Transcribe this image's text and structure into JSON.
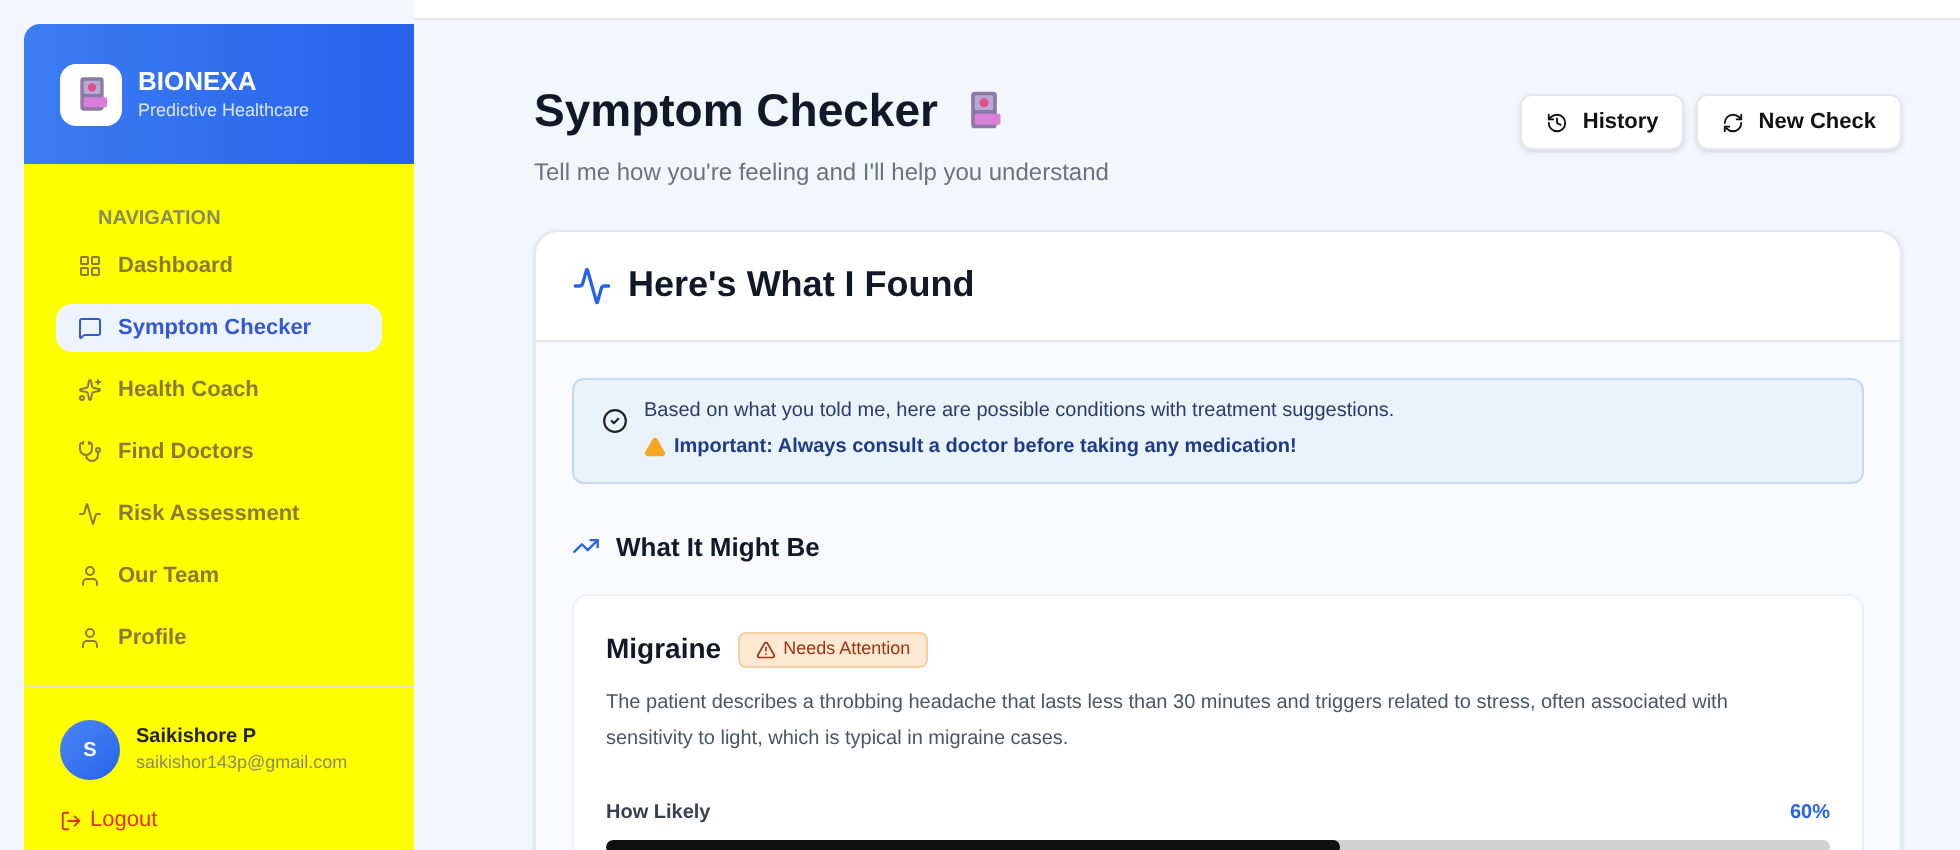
{
  "brand": {
    "name": "BIONEXA",
    "tagline": "Predictive Healthcare"
  },
  "navigation": {
    "heading": "NAVIGATION",
    "items": [
      {
        "label": "Dashboard",
        "kind": "dashboard",
        "selected": false
      },
      {
        "label": "Symptom Checker",
        "kind": "chat",
        "selected": true
      },
      {
        "label": "Health Coach",
        "kind": "coach",
        "selected": false
      },
      {
        "label": "Find Doctors",
        "kind": "doctors",
        "selected": false
      },
      {
        "label": "Risk Assessment",
        "kind": "risk",
        "selected": false
      },
      {
        "label": "Our Team",
        "kind": "team",
        "selected": false
      },
      {
        "label": "Profile",
        "kind": "profile",
        "selected": false
      }
    ]
  },
  "user": {
    "initial": "S",
    "name": "Saikishore P",
    "email": "saikishor143p@gmail.com"
  },
  "logout": "Logout",
  "page": {
    "title": "Symptom Checker",
    "subtitle": "Tell me how you're feeling and I'll help you understand"
  },
  "actions": [
    {
      "label": "History",
      "kind": "history"
    },
    {
      "label": "New Check",
      "kind": "refresh"
    }
  ],
  "results": {
    "title": "Here's What I Found",
    "notice": {
      "text": "Based on what you told me, here are possible conditions with treatment suggestions.",
      "warning": "Important: Always consult a doctor before taking any medication!"
    },
    "section_title": "What It Might Be",
    "conditions": [
      {
        "name": "Migraine",
        "badge": "Needs Attention",
        "description": "The patient describes a throbbing headache that lasts less than 30 minutes and triggers related to stress, often associated with sensitivity to light, which is typical in migraine cases.",
        "likelihood_label": "How Likely",
        "likelihood_reading": "60%",
        "level": 0.6
      }
    ]
  }
}
